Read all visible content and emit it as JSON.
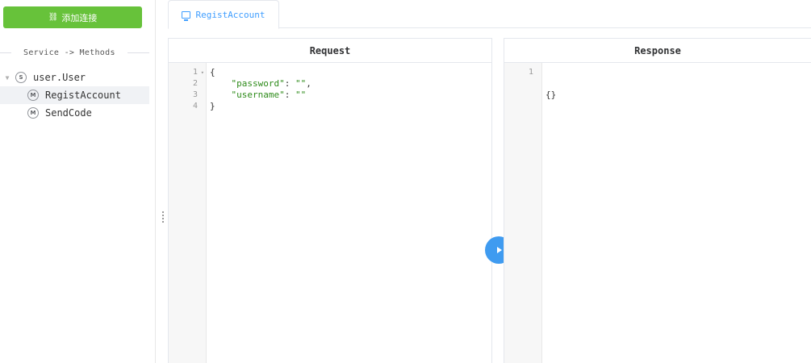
{
  "sidebar": {
    "add_button_label": "添加连接",
    "divider_text": "Service -> Methods",
    "tree": {
      "service": {
        "badge": "S",
        "label": "user.User"
      },
      "methods": [
        {
          "badge": "M",
          "label": "RegistAccount",
          "active": true
        },
        {
          "badge": "M",
          "label": "SendCode",
          "active": false
        }
      ]
    }
  },
  "tabs": [
    {
      "label": "RegistAccount",
      "icon": "monitor-icon",
      "active": true
    }
  ],
  "request": {
    "title": "Request",
    "line_numbers": [
      "1",
      "2",
      "3",
      "4"
    ],
    "lines": [
      "{",
      "    \"password\": \"\",",
      "    \"username\": \"\"",
      "}"
    ]
  },
  "response": {
    "title": "Response",
    "line_numbers": [
      "1"
    ],
    "lines": [
      "{}"
    ]
  },
  "colors": {
    "add_button": "#67c23a",
    "accent": "#409eff",
    "run_button": "#3f9bf0",
    "json_string": "#2e8b1a"
  }
}
